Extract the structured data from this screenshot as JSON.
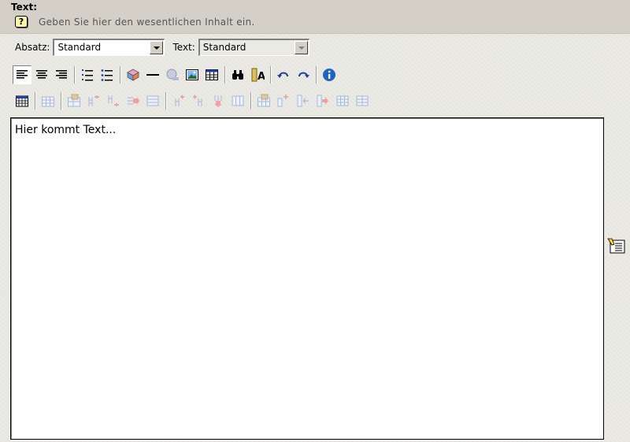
{
  "field": {
    "label": "Text:",
    "help_text": "Geben Sie hier den wesentlichen Inhalt ein.",
    "help_icon_glyph": "?"
  },
  "format_bar": {
    "paragraph_label": "Absatz:",
    "paragraph_value": "Standard",
    "text_label": "Text:",
    "text_value": "Standard"
  },
  "toolbar1": [
    "align-left-icon",
    "align-center-icon",
    "align-right-icon",
    "ordered-list-icon",
    "unordered-list-icon",
    "insert-object-icon",
    "horizontal-rule-icon",
    "insert-link-icon",
    "insert-image-icon",
    "insert-table-icon",
    "find-icon",
    "spellcheck-icon",
    "undo-icon",
    "redo-icon",
    "info-icon"
  ],
  "toolbar2": [
    "table-grid-icon",
    "table-properties-icon",
    "cell-properties-icon",
    "insert-column-before-icon",
    "insert-column-after-icon",
    "delete-column-icon",
    "merge-cells-icon",
    "insert-row-before-icon",
    "insert-row-after-icon",
    "delete-row-icon",
    "split-cell-icon"
  ],
  "editor": {
    "content": "Hier kommt Text..."
  },
  "colors": {
    "header_band": "#d4d0c8",
    "info_blue": "#1f63c6",
    "disabled_gray": "#a9b8d8"
  }
}
